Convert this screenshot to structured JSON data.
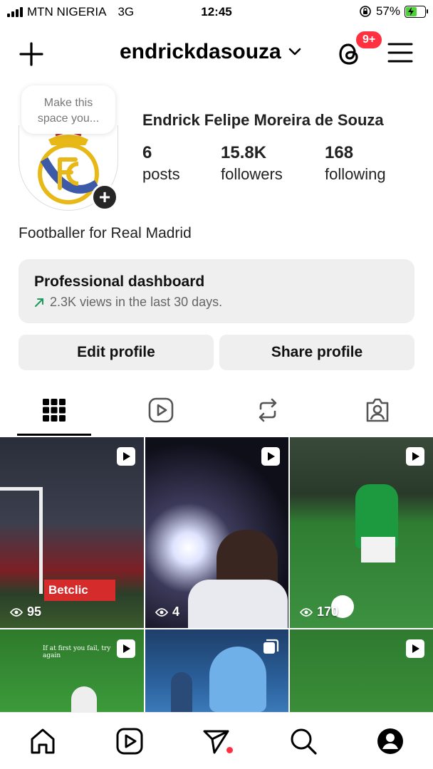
{
  "status_bar": {
    "carrier": "MTN NIGERIA",
    "network": "3G",
    "time": "12:45",
    "battery": "57%",
    "battery_level": 0.57
  },
  "header": {
    "username": "endrickdasouza",
    "notification_badge": "9+",
    "icons": [
      "plus-icon",
      "chevron-down-icon",
      "threads-icon",
      "menu-icon"
    ]
  },
  "profile": {
    "note_placeholder": "Make this space you...",
    "full_name": "Endrick Felipe Moreira de Souza",
    "stats": [
      {
        "value": "6",
        "label": "posts"
      },
      {
        "value": "15.8K",
        "label": "followers"
      },
      {
        "value": "168",
        "label": "following"
      }
    ],
    "bio": "Footballer for Real Madrid"
  },
  "dashboard": {
    "title": "Professional dashboard",
    "subtitle": "2.3K views in the last 30 days."
  },
  "buttons": {
    "edit": "Edit profile",
    "share": "Share profile"
  },
  "tabs": [
    "grid-icon",
    "reels-icon",
    "reposts-icon",
    "tagged-icon"
  ],
  "posts": [
    {
      "views": "95",
      "type": "reel"
    },
    {
      "views": "4",
      "type": "reel"
    },
    {
      "views": "170",
      "type": "reel"
    },
    {
      "overlay_text": "If at first you fail, try again",
      "type": "reel"
    },
    {
      "type": "carousel"
    },
    {
      "type": "reel"
    }
  ],
  "bottom_nav": [
    "home-icon",
    "reels-icon",
    "messages-icon",
    "search-icon",
    "profile-icon"
  ],
  "colors": {
    "badge": "#ff3040",
    "dashboard_bg": "#efefef",
    "trend_green": "#1a9c5b"
  }
}
